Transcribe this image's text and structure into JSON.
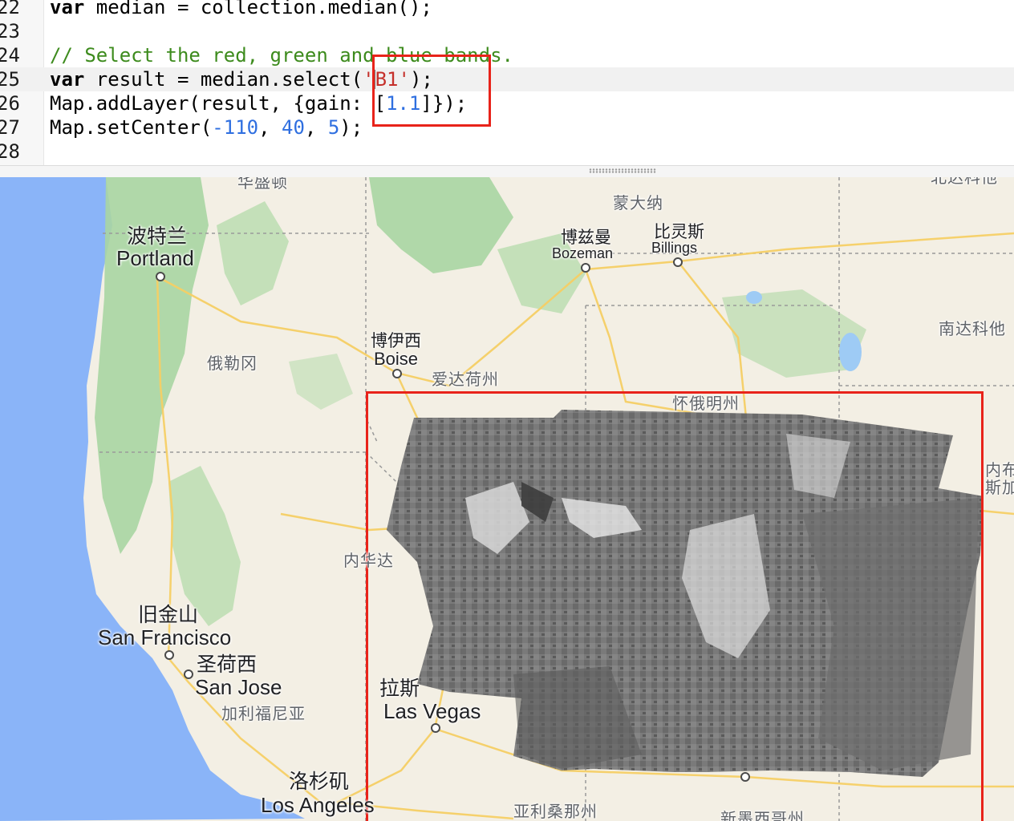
{
  "editor": {
    "lines": [
      {
        "num": "22",
        "tokens": [
          {
            "t": "var",
            "c": "kw"
          },
          {
            "t": " median = collection.median();",
            "c": ""
          }
        ]
      },
      {
        "num": "23",
        "tokens": []
      },
      {
        "num": "24",
        "tokens": [
          {
            "t": "// Select the red, green and blue bands.",
            "c": "cm"
          }
        ]
      },
      {
        "num": "25",
        "active": true,
        "tokens": [
          {
            "t": "var",
            "c": "kw"
          },
          {
            "t": " result = median.select(",
            "c": ""
          },
          {
            "t": "'",
            "c": "str"
          },
          {
            "t": "",
            "c": "cursor"
          },
          {
            "t": "B1'",
            "c": "str"
          },
          {
            "t": ");",
            "c": ""
          }
        ]
      },
      {
        "num": "26",
        "tokens": [
          {
            "t": "Map.addLayer(result, {gain: [",
            "c": ""
          },
          {
            "t": "1.1",
            "c": "num"
          },
          {
            "t": "]});",
            "c": ""
          }
        ]
      },
      {
        "num": "27",
        "tokens": [
          {
            "t": "Map.setCenter(",
            "c": ""
          },
          {
            "t": "-110",
            "c": "num"
          },
          {
            "t": ", ",
            "c": ""
          },
          {
            "t": "40",
            "c": "num"
          },
          {
            "t": ", ",
            "c": ""
          },
          {
            "t": "5",
            "c": "num"
          },
          {
            "t": ");",
            "c": ""
          }
        ]
      },
      {
        "num": "28",
        "tokens": []
      }
    ]
  },
  "map": {
    "labels": {
      "washington": "华盛顿",
      "montana": "蒙大纳",
      "north_dakota": "北达科他",
      "south_dakota": "南达科他",
      "bozeman_cn": "博兹曼",
      "bozeman_en": "Bozeman",
      "billings_cn": "比灵斯",
      "billings_en": "Billings",
      "portland_cn": "波特兰",
      "portland_en": "Portland",
      "oregon": "俄勒冈",
      "boise_cn": "博伊西",
      "boise_en": "Boise",
      "idaho": "爱达荷州",
      "wyoming": "怀俄明州",
      "nebraska": "内布",
      "nebraska2": "斯加",
      "nevada": "内华达",
      "sf_cn": "旧金山",
      "sf_en": "San Francisco",
      "sj_cn": "圣荷西",
      "sj_en": "San Jose",
      "california": "加利福尼亚",
      "lv_cn": "拉斯",
      "lv_en": "Las Vegas",
      "la_cn": "洛杉矶",
      "la_en": "Los Angeles",
      "arizona": "亚利桑那州",
      "new_mexico": "新墨西哥州"
    },
    "colors": {
      "ocean": "#8ab4f8",
      "land": "#f3efe4",
      "forest": "#a8d5a2",
      "roads": "#f6cf65",
      "annotation": "#e8231a"
    }
  }
}
